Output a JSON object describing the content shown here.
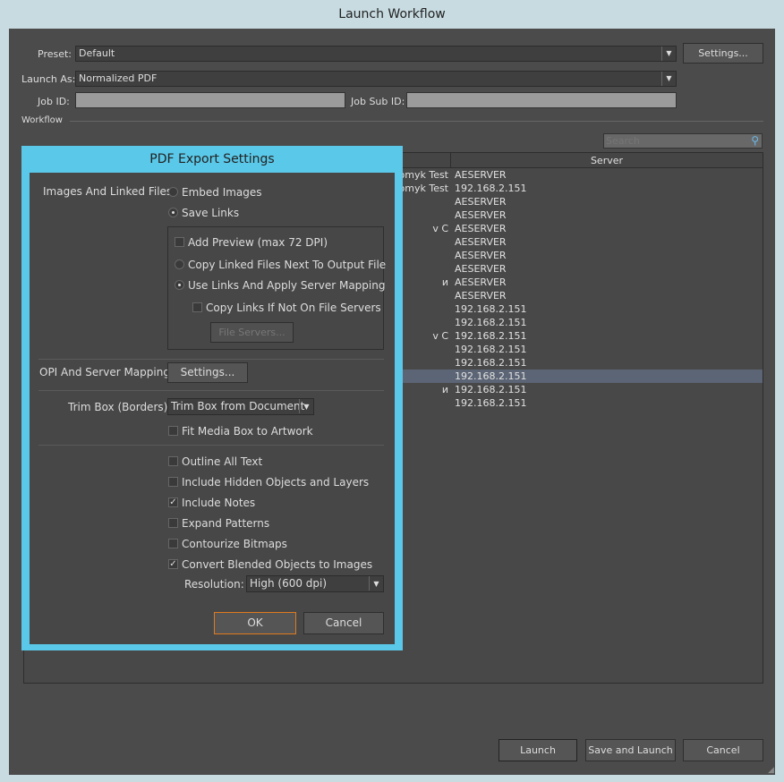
{
  "window": {
    "title": "Launch Workflow"
  },
  "form": {
    "preset_label": "Preset:",
    "preset_value": "Default",
    "settings_button": "Settings...",
    "launch_as_label": "Launch As:",
    "launch_as_value": "Normalized PDF",
    "job_id_label": "Job ID:",
    "job_id_value": "",
    "job_sub_id_label": "Job Sub ID:",
    "job_sub_id_value": "",
    "workflow_label": "Workflow"
  },
  "search": {
    "placeholder": "Search"
  },
  "table": {
    "columns": [
      "",
      "Server"
    ],
    "rows": [
      {
        "name": "omyk Test",
        "server": "AESERVER"
      },
      {
        "name": "omyk Test",
        "server": "192.168.2.151"
      },
      {
        "name": "",
        "server": "AESERVER"
      },
      {
        "name": "",
        "server": "AESERVER"
      },
      {
        "name": "v C",
        "server": "AESERVER"
      },
      {
        "name": "",
        "server": "AESERVER"
      },
      {
        "name": "",
        "server": "AESERVER"
      },
      {
        "name": "",
        "server": "AESERVER"
      },
      {
        "name": "и",
        "server": "AESERVER"
      },
      {
        "name": "",
        "server": "AESERVER"
      },
      {
        "name": "",
        "server": "192.168.2.151"
      },
      {
        "name": "",
        "server": "192.168.2.151"
      },
      {
        "name": "v C",
        "server": "192.168.2.151"
      },
      {
        "name": "",
        "server": "192.168.2.151"
      },
      {
        "name": "",
        "server": "192.168.2.151"
      },
      {
        "name": "",
        "server": "192.168.2.151"
      },
      {
        "name": "и",
        "server": "192.168.2.151"
      },
      {
        "name": "",
        "server": "192.168.2.151"
      }
    ],
    "selected_index": 15
  },
  "footer": {
    "launch": "Launch",
    "save_and_launch": "Save and Launch",
    "cancel": "Cancel"
  },
  "dialog": {
    "title": "PDF Export Settings",
    "images_label": "Images And Linked Files:",
    "embed_images": "Embed Images",
    "save_links": "Save Links",
    "add_preview": "Add Preview (max 72 DPI)",
    "copy_linked": "Copy Linked Files Next To Output File",
    "use_links": "Use Links And Apply Server Mapping",
    "copy_links_not_on_servers": "Copy Links If Not On File Servers",
    "file_servers_button": "File Servers...",
    "opi_label": "OPI And Server Mapping:",
    "opi_settings_button": "Settings...",
    "trim_label": "Trim Box (Borders):",
    "trim_value": "Trim Box from Document",
    "fit_media": "Fit Media Box to Artwork",
    "outline_text": "Outline All Text",
    "include_hidden": "Include Hidden Objects and Layers",
    "include_notes": "Include Notes",
    "expand_patterns": "Expand Patterns",
    "contourize": "Contourize Bitmaps",
    "convert_blended": "Convert Blended Objects to Images",
    "resolution_label": "Resolution:",
    "resolution_value": "High (600 dpi)",
    "ok": "OK",
    "cancel": "Cancel"
  }
}
